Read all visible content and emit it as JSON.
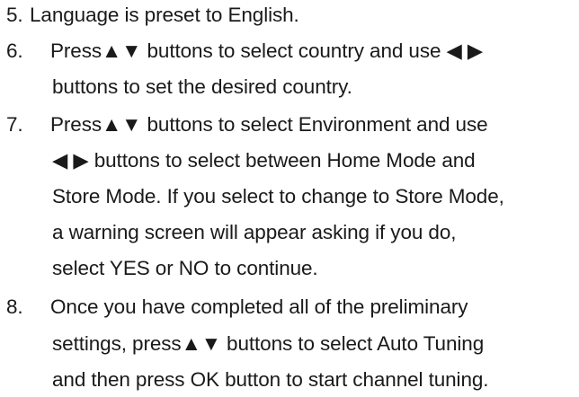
{
  "instructions": {
    "items": [
      {
        "number": "5.",
        "lines": [
          "Language is preset to English."
        ]
      },
      {
        "number": "6.",
        "lines": [
          "Press▲▼ buttons to select country and use ◀ ▶",
          "buttons to set the desired country."
        ]
      },
      {
        "number": "7.",
        "lines": [
          "Press▲▼ buttons to select Environment and use",
          "◀ ▶ buttons to select between Home Mode and",
          "Store Mode. If you select to change to Store Mode,",
          "a warning screen will appear asking if you do,",
          "select YES or NO to continue."
        ]
      },
      {
        "number": "8.",
        "lines": [
          "Once you have completed all of the preliminary",
          "settings, press▲▼ buttons to select Auto Tuning",
          "and then press OK button to start channel tuning."
        ]
      }
    ]
  }
}
